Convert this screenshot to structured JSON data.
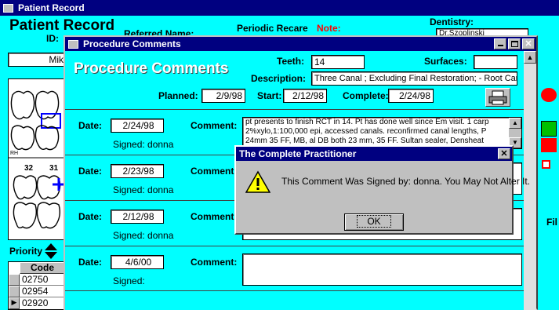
{
  "back_window": {
    "title": "Patient Record",
    "heading": "Patient Record",
    "id_label": "ID:",
    "patient_name": "Mik",
    "referred_label": "Referred Name:",
    "recare_label": "Periodic Recare",
    "note_label": "Note:",
    "dentistry_label": "Dentistry:",
    "dentist_value": "Dr.Szoplinski",
    "priority_label": "Priority",
    "code_header": "Code",
    "codes": [
      "02750",
      "02954",
      "02920"
    ],
    "fi_label": "Fil",
    "tooth_nums": [
      "32",
      "31"
    ],
    "rh_label": "RH"
  },
  "proc_window": {
    "title": "Procedure Comments",
    "heading": "Procedure Comments",
    "teeth_label": "Teeth:",
    "teeth_value": "14",
    "surfaces_label": "Surfaces:",
    "surfaces_value": "",
    "description_label": "Description:",
    "description_value": "Three Canal ; Excluding Final  Restoration;  - Root Canal",
    "planned_label": "Planned:",
    "planned_value": "2/9/98",
    "start_label": "Start:",
    "start_value": "2/12/98",
    "complete_label": "Complete:",
    "complete_value": "2/24/98",
    "date_label": "Date:",
    "comment_label": "Comment:",
    "signed_label": "Signed:",
    "records": [
      {
        "date": "2/24/98",
        "signed": "Signed:  donna",
        "comment": "pt presents to finish RCT in 14. Pt has done well since Em visit. 1 carp 2%xylo,1:100,000 epi, accessed canals. reconfirmed canal lengths, P 24mm 35 FF, MB, al DB both 23 mm, 35 FF. Sultan sealer, Densheat"
      },
      {
        "date": "2/23/98",
        "signed": "Signed:  donna",
        "comment": ""
      },
      {
        "date": "2/12/98",
        "signed": "Signed:  donna",
        "comment": ""
      },
      {
        "date": "4/6/00",
        "signed": "Signed:",
        "comment": ""
      }
    ]
  },
  "dialog": {
    "title": "The Complete Practitioner",
    "message": "This Comment Was Signed by: donna. You May Not Alter It.",
    "ok_label": "OK"
  }
}
